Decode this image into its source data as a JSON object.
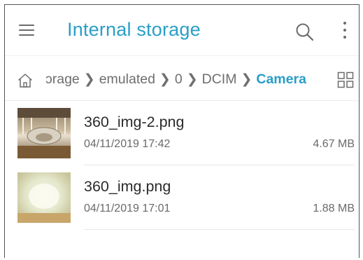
{
  "appbar": {
    "title": "Internal storage",
    "menu_icon": "hamburger-menu-icon",
    "search_icon": "search-icon",
    "more_icon": "more-vertical-icon"
  },
  "breadcrumb": {
    "home_icon": "home-icon",
    "items": [
      "ɔrage",
      "emulated",
      "0",
      "DCIM",
      "Camera"
    ],
    "view_icon": "grid-view-icon"
  },
  "files": [
    {
      "name": "360_img-2.png",
      "date": "04/11/2019 17:42",
      "size": "4.67 MB"
    },
    {
      "name": "360_img.png",
      "date": "04/11/2019 17:01",
      "size": "1.88 MB"
    }
  ],
  "colors": {
    "accent": "#2a9ec7",
    "icon": "#6b6b6b",
    "text_primary": "#2b2b2b",
    "text_secondary": "#6a6a6a"
  }
}
